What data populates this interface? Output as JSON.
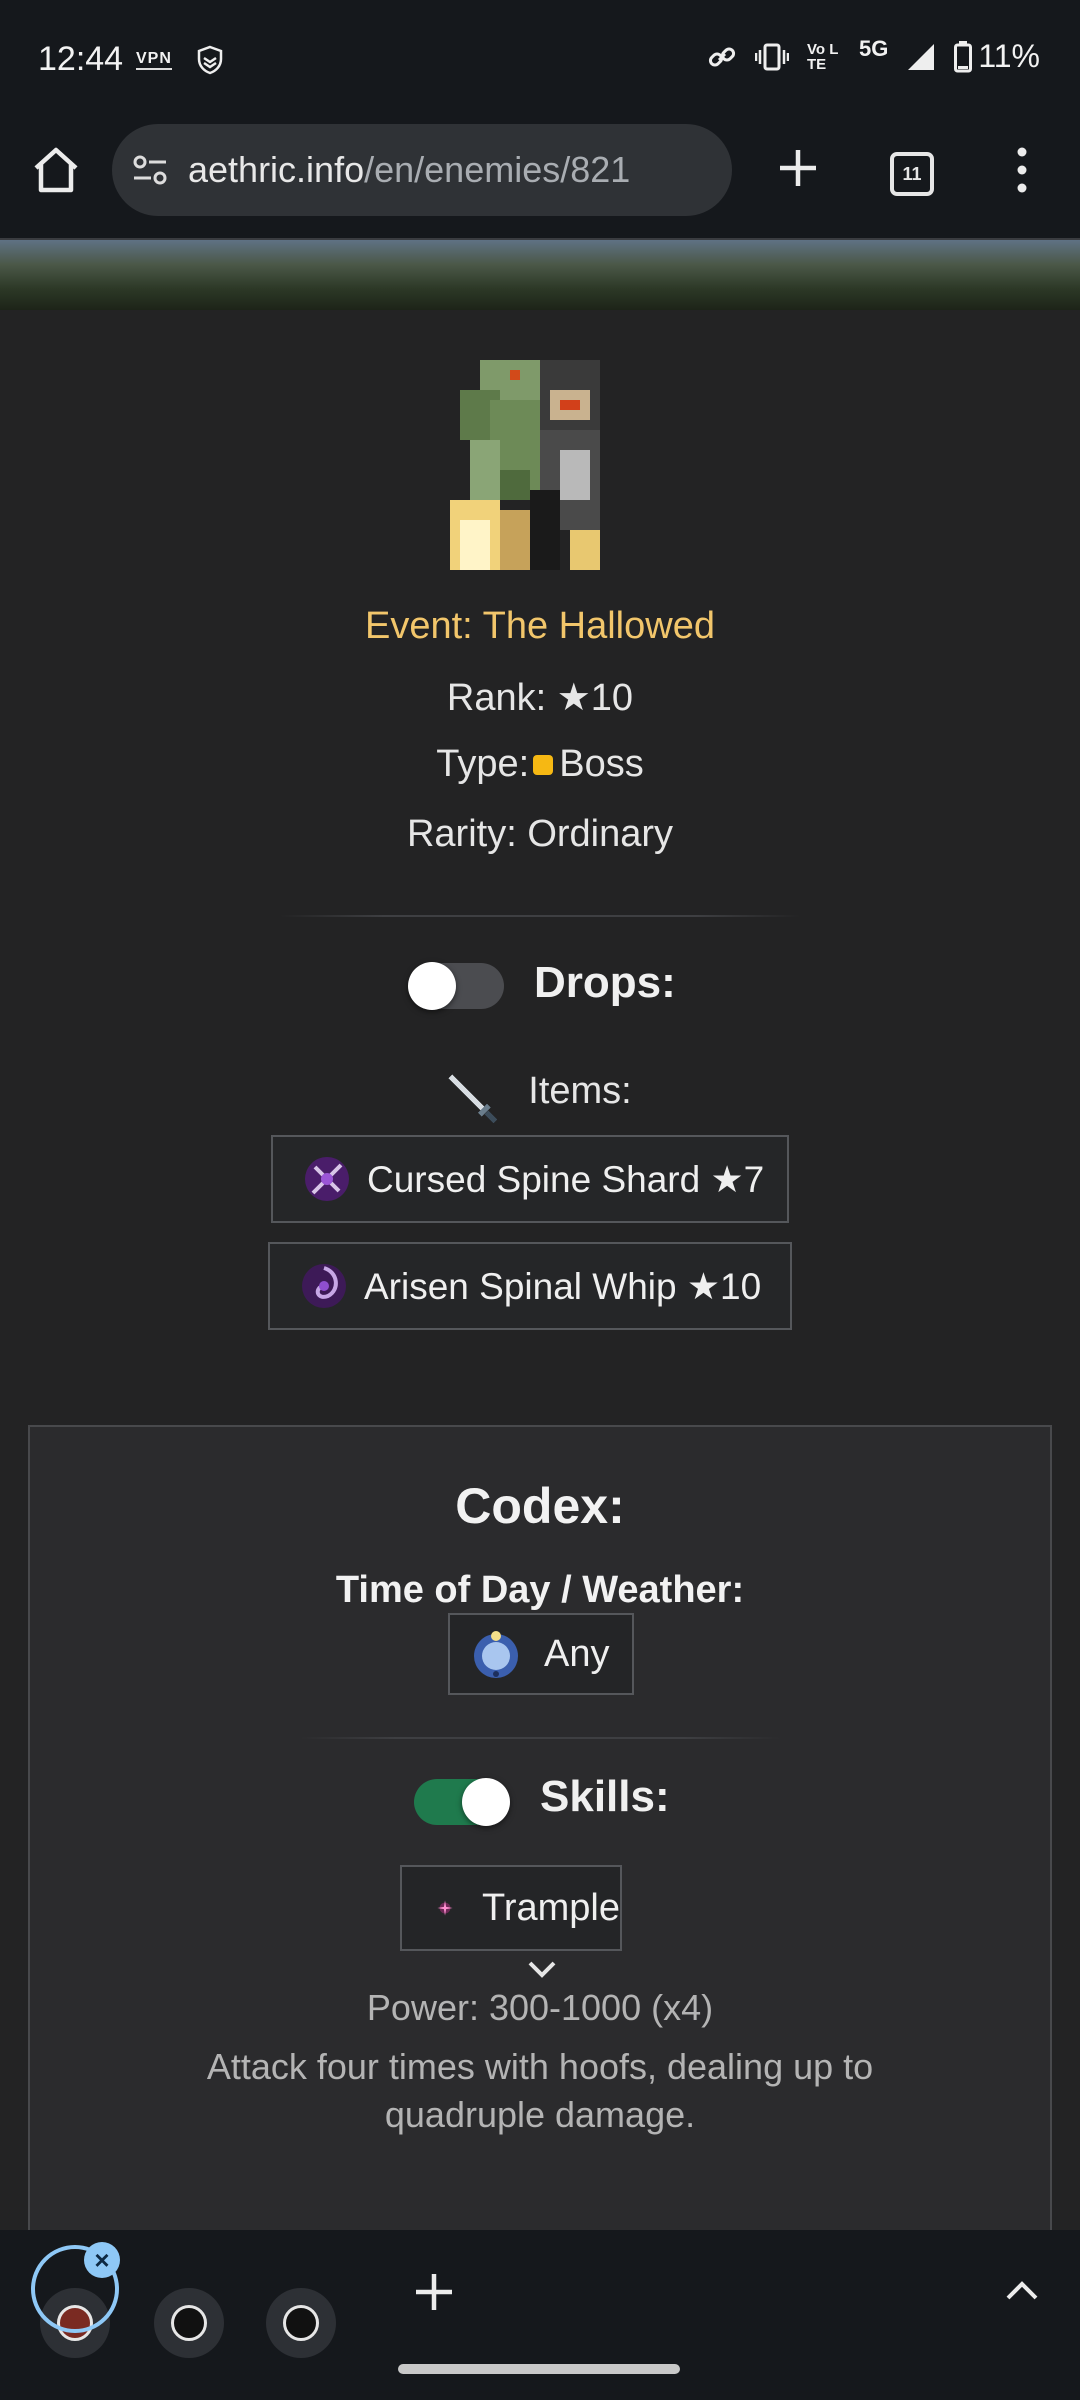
{
  "status_bar": {
    "time": "12:44",
    "vpn_label": "VPN",
    "volte_label": "Vo LTE",
    "network_label": "5G",
    "battery_text": "11%"
  },
  "browser": {
    "url_host": "aethric.info",
    "url_path": "/en/enemies/821",
    "tab_count": "11"
  },
  "enemy": {
    "event": "Event: The Hallowed",
    "rank": "Rank: ★10",
    "type_label": "Type:",
    "type_value": "Boss",
    "type_color": "#f6b813",
    "rarity": "Rarity: Ordinary"
  },
  "drops": {
    "title": "Drops:",
    "toggle_on": false,
    "items_label": "Items:",
    "items": [
      {
        "name": "Cursed Spine Shard ★7",
        "icon": "cursed-spine-shard-icon"
      },
      {
        "name": "Arisen Spinal Whip ★10",
        "icon": "arisen-spinal-whip-icon"
      }
    ]
  },
  "codex": {
    "title": "Codex:",
    "time_weather_label": "Time of Day / Weather:",
    "time_weather_value": "Any",
    "skills_title": "Skills:",
    "skills_toggle_on": true,
    "skill_name": "Trample",
    "skill_power": "Power: 300-1000 (x4)",
    "skill_description": "Attack four times with hoofs, dealing up to quadruple damage."
  },
  "colors": {
    "accent_event": "#f2c66b",
    "toggle_on": "#1f7a4d",
    "background": "#232324"
  }
}
